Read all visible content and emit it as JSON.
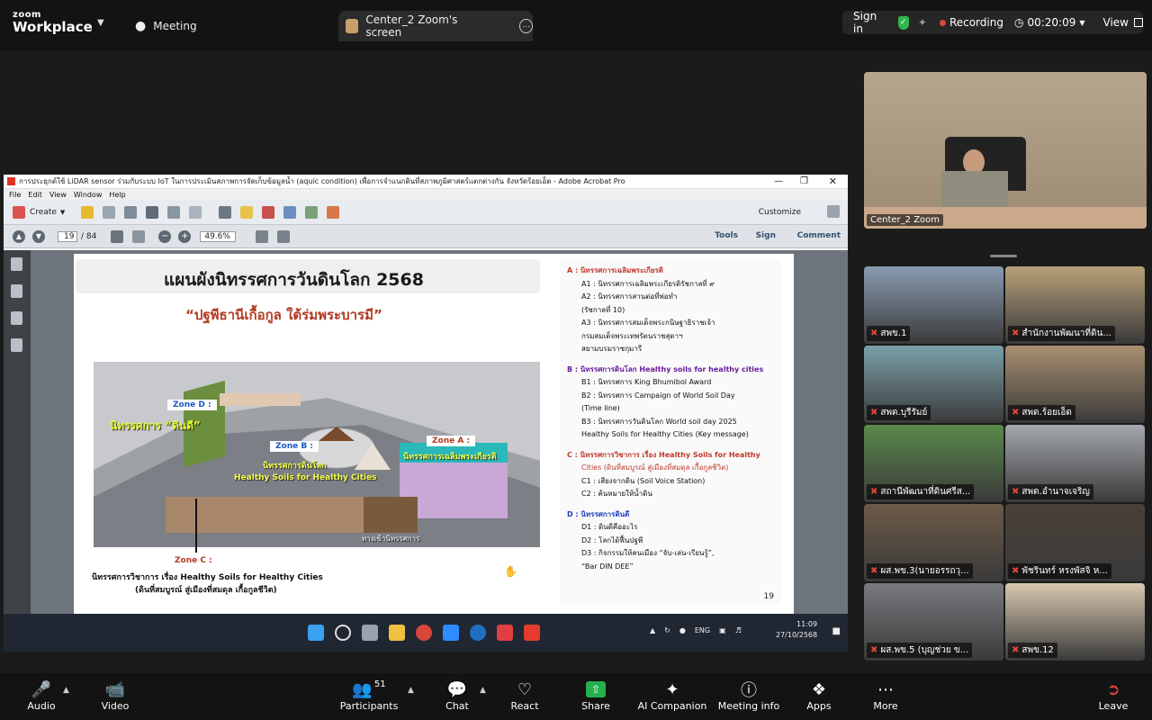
{
  "topbar": {
    "brand_top": "zoom",
    "brand_bottom": "Workplace",
    "meeting_tab": "Meeting",
    "screen_tab": "Center_2 Zoom's screen",
    "signin": "Sign in",
    "recording": "Recording",
    "timer": "00:20:09",
    "view": "View"
  },
  "acrobat": {
    "title": "การประยุกต์ใช้ LiDAR sensor ร่วมกับระบบ IoT ในการประเมินสภาพการจัดเก็บข้อมูลน้ำ (aquic condition) เพื่อการจำแนกดินที่สภาพภูมิศาสตร์แตกต่างกัน จังหวัดร้อยเอ็ด - Adobe Acrobat Pro",
    "menu": [
      "File",
      "Edit",
      "View",
      "Window",
      "Help"
    ],
    "create": "Create",
    "customize": "Customize",
    "page_current": "19",
    "page_total": "/ 84",
    "zoom": "49.6%",
    "right_tabs": [
      "Tools",
      "Sign",
      "Comment"
    ]
  },
  "slide": {
    "title": "แผนผังนิทรรศการวันดินโลก 2568",
    "subtitle": "“ปฐพีธานีเกื้อกูล ใต้ร่มพระบารมี”",
    "zone_d": "Zone D :",
    "zone_d_name": "นิทรรศการ “ดินดี”",
    "zone_b": "Zone B :",
    "zone_b_name": "นิทรรศการดินโลก",
    "zone_b_sub": "Healthy Soils for Healthy Cities",
    "zone_a": "Zone A :",
    "zone_a_name": "นิทรรศการเฉลิมพระเกียรติ",
    "entrance": "ทางเข้านิทรรศการ",
    "zone_c": "Zone C :",
    "zone_c_line1": "นิทรรศการวิชาการ เรื่อง Healthy Soils for Healthy Cities",
    "zone_c_line2": "(ดินที่สมบูรณ์ สู่เมืองที่สมดุล เกื้อกูลชีวิต)",
    "page_number": "19",
    "legend": [
      {
        "head": "A : นิทรรศการเฉลิมพระเกียรติ",
        "color": "#c0392b",
        "items": [
          "A1 : นิทรรศการเฉลิมพระเกียรติรัชกาลที่ ๙",
          "A2 : นิทรรศการสานต่อที่พ่อทำ",
          "(รัชกาลที่ 10)",
          "A3 : นิทรรศการสมเด็จพระกนิษฐาธิราชเจ้า",
          "กรมสมเด็จพระเทพรัตนราชสุดาฯ",
          "สยามบรมราชกุมารี"
        ]
      },
      {
        "head": "B : นิทรรศการดินโลก Healthy soils for healthy cities",
        "color": "#6a1b9a",
        "items": [
          "B1 : นิทรรศการ King Bhumibol Award",
          "B2 : นิทรรศการ Campaign of World Soil Day",
          "(Time line)",
          "B3 : นิทรรศการวันดินโลก World soil day 2025",
          "Healthy Soils for Healthy Cities (Key message)"
        ]
      },
      {
        "head": "C : นิทรรศการวิชาการ เรื่อง Healthy Soils for Healthy",
        "color": "#c0392b",
        "items": [
          "Cities (ดินที่สมบูรณ์ สู่เมืองที่สมดุล เกื้อกูลชีวิต)",
          "C1 : เสียงจากดิน (Soil Voice Station)",
          "C2 : ค้นหมายให้น้ำดิน"
        ]
      },
      {
        "head": "D : นิทรรศการดินดี",
        "color": "#1f3fbf",
        "items": [
          "D1 : ดินดีคืออะไร",
          "D2 : โลกได้ฟื้นปฐพี",
          "D3 : กิจกรรมให้คนเมือง “จับ-เล่น-เรียนรู้”,",
          "“Bar DIN DEE”"
        ]
      }
    ]
  },
  "taskbar": {
    "lang": "ENG",
    "time": "11:09",
    "date": "27/10/2568"
  },
  "gallery": {
    "main_label": "Center_2 Zoom",
    "tiles": [
      "สพข.1",
      "สำนักงานพัฒนาที่ดิน...",
      "สพด.บุรีรัมย์",
      "สพด.ร้อยเอ็ด",
      "สถานีพัฒนาที่ดินศรีส...",
      "สพด.อำนาจเจริญ",
      "ผส.พข.3(นายอรรถวุ...",
      "พัชรินทร์ หรงพัสจิ ห...",
      "ผส.พข.5 (บุญช่วย ข...",
      "สพข.12"
    ]
  },
  "bottombar": {
    "audio": "Audio",
    "video": "Video",
    "participants": "Participants",
    "participants_count": "51",
    "chat": "Chat",
    "react": "React",
    "share": "Share",
    "companion": "AI Companion",
    "meeting_info": "Meeting info",
    "apps": "Apps",
    "more": "More",
    "leave": "Leave"
  }
}
